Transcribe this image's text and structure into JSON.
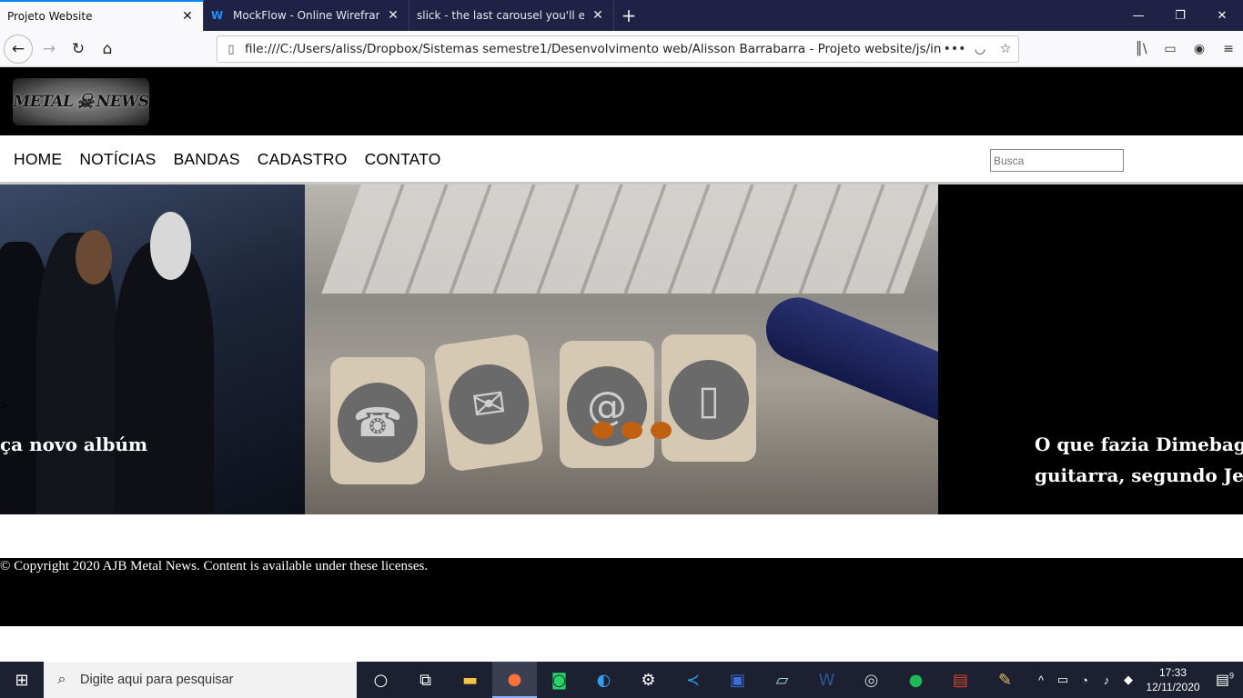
{
  "browser": {
    "tabs": [
      {
        "title": "Projeto Website",
        "active": true
      },
      {
        "title": "MockFlow - Online Wirefram",
        "active": false
      },
      {
        "title": "slick - the last carousel you'll ever n",
        "active": false
      }
    ],
    "new_tab": "+",
    "url": "file:///C:/Users/aliss/Dropbox/Sistemas semestre1/Desenvolvimento web/Alisson Barrabarra - Projeto website/js/index.htm",
    "window_controls": {
      "minimize": "—",
      "restore": "❐",
      "close": "✕"
    }
  },
  "site": {
    "logo": {
      "left": "METAL",
      "right": "NEWS"
    },
    "nav": [
      "HOME",
      "NOTÍCIAS",
      "BANDAS",
      "CADASTRO",
      "CONTATO"
    ],
    "search_placeholder": "Busca",
    "slides": [
      {
        "caption": "ça novo albúm"
      },
      {
        "caption": ""
      },
      {
        "caption_line1": "O que fazia Dimebag",
        "caption_line2": "guitarra, segundo Jer"
      }
    ],
    "stray_text": ">",
    "dots_count": 3,
    "footer": "© Copyright 2020 AJB Metal News. Content is available under these licenses."
  },
  "taskbar": {
    "search_placeholder": "Digite aqui para pesquisar",
    "time": "17:33",
    "date": "12/11/2020",
    "notifications": "9"
  },
  "colors": {
    "dots": "#c06010",
    "tabbar": "#1f2244",
    "taskbar": "#1c2030"
  }
}
